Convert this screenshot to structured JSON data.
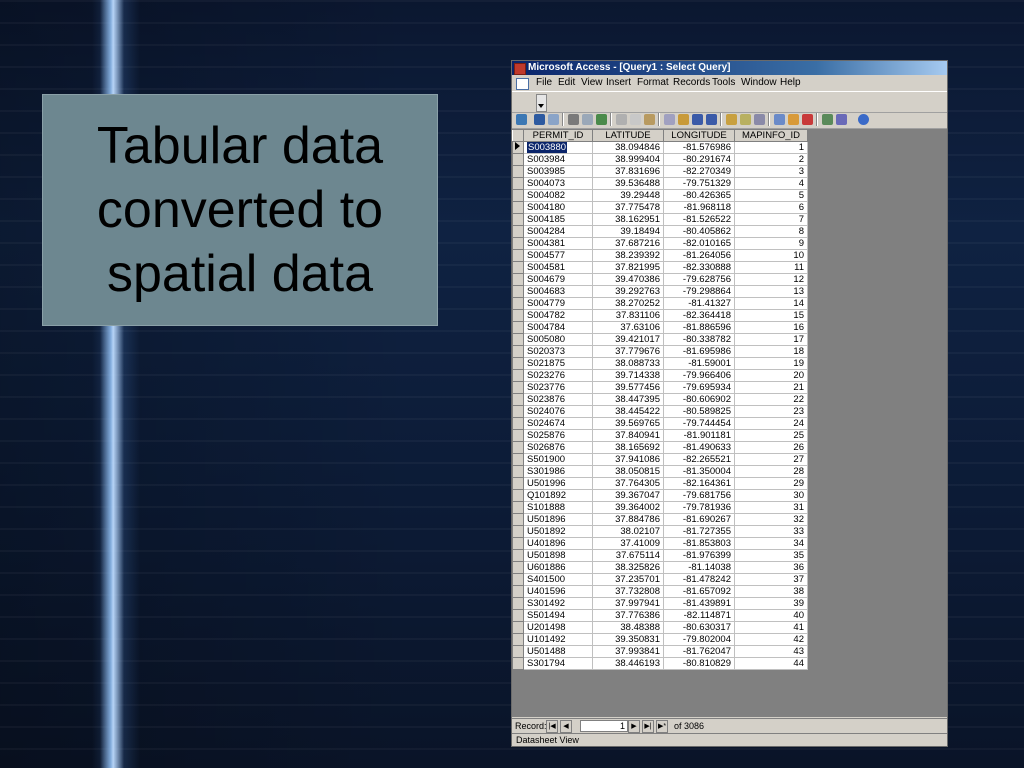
{
  "slide": {
    "title_lines": [
      "Tabular data",
      "converted to",
      "spatial data"
    ]
  },
  "window": {
    "title": "Microsoft Access - [Query1 : Select Query]",
    "menu": [
      "File",
      "Edit",
      "View",
      "Insert",
      "Format",
      "Records",
      "Tools",
      "Window",
      "Help"
    ]
  },
  "table": {
    "columns": [
      "PERMIT_ID",
      "LATITUDE",
      "LONGITUDE",
      "MAPINFO_ID"
    ],
    "rows": [
      [
        "S003880",
        "38.094846",
        "-81.576986",
        "1"
      ],
      [
        "S003984",
        "38.999404",
        "-80.291674",
        "2"
      ],
      [
        "S003985",
        "37.831696",
        "-82.270349",
        "3"
      ],
      [
        "S004073",
        "39.536488",
        "-79.751329",
        "4"
      ],
      [
        "S004082",
        "39.29448",
        "-80.426365",
        "5"
      ],
      [
        "S004180",
        "37.775478",
        "-81.968118",
        "6"
      ],
      [
        "S004185",
        "38.162951",
        "-81.526522",
        "7"
      ],
      [
        "S004284",
        "39.18494",
        "-80.405862",
        "8"
      ],
      [
        "S004381",
        "37.687216",
        "-82.010165",
        "9"
      ],
      [
        "S004577",
        "38.239392",
        "-81.264056",
        "10"
      ],
      [
        "S004581",
        "37.821995",
        "-82.330888",
        "11"
      ],
      [
        "S004679",
        "39.470386",
        "-79.628756",
        "12"
      ],
      [
        "S004683",
        "39.292763",
        "-79.298864",
        "13"
      ],
      [
        "S004779",
        "38.270252",
        "-81.41327",
        "14"
      ],
      [
        "S004782",
        "37.831106",
        "-82.364418",
        "15"
      ],
      [
        "S004784",
        "37.63106",
        "-81.886596",
        "16"
      ],
      [
        "S005080",
        "39.421017",
        "-80.338782",
        "17"
      ],
      [
        "S020373",
        "37.779676",
        "-81.695986",
        "18"
      ],
      [
        "S021875",
        "38.088733",
        "-81.59001",
        "19"
      ],
      [
        "S023276",
        "39.714338",
        "-79.966406",
        "20"
      ],
      [
        "S023776",
        "39.577456",
        "-79.695934",
        "21"
      ],
      [
        "S023876",
        "38.447395",
        "-80.606902",
        "22"
      ],
      [
        "S024076",
        "38.445422",
        "-80.589825",
        "23"
      ],
      [
        "S024674",
        "39.569765",
        "-79.744454",
        "24"
      ],
      [
        "S025876",
        "37.840941",
        "-81.901181",
        "25"
      ],
      [
        "S026876",
        "38.165692",
        "-81.490633",
        "26"
      ],
      [
        "S501900",
        "37.941086",
        "-82.265521",
        "27"
      ],
      [
        "S301986",
        "38.050815",
        "-81.350004",
        "28"
      ],
      [
        "U501996",
        "37.764305",
        "-82.164361",
        "29"
      ],
      [
        "Q101892",
        "39.367047",
        "-79.681756",
        "30"
      ],
      [
        "S101888",
        "39.364002",
        "-79.781936",
        "31"
      ],
      [
        "U501896",
        "37.884786",
        "-81.690267",
        "32"
      ],
      [
        "U501892",
        "38.02107",
        "-81.727355",
        "33"
      ],
      [
        "U401896",
        "37.41009",
        "-81.853803",
        "34"
      ],
      [
        "U501898",
        "37.675114",
        "-81.976399",
        "35"
      ],
      [
        "U601886",
        "38.325826",
        "-81.14038",
        "36"
      ],
      [
        "S401500",
        "37.235701",
        "-81.478242",
        "37"
      ],
      [
        "U401596",
        "37.732808",
        "-81.657092",
        "38"
      ],
      [
        "S301492",
        "37.997941",
        "-81.439891",
        "39"
      ],
      [
        "S501494",
        "37.776386",
        "-82.114871",
        "40"
      ],
      [
        "U201498",
        "38.48388",
        "-80.630317",
        "41"
      ],
      [
        "U101492",
        "39.350831",
        "-79.802004",
        "42"
      ],
      [
        "U501488",
        "37.993841",
        "-81.762047",
        "43"
      ],
      [
        "S301794",
        "38.446193",
        "-80.810829",
        "44"
      ]
    ]
  },
  "navigation": {
    "label": "Record:",
    "current": "1",
    "of_text": "of  3086"
  },
  "status": "Datasheet View"
}
